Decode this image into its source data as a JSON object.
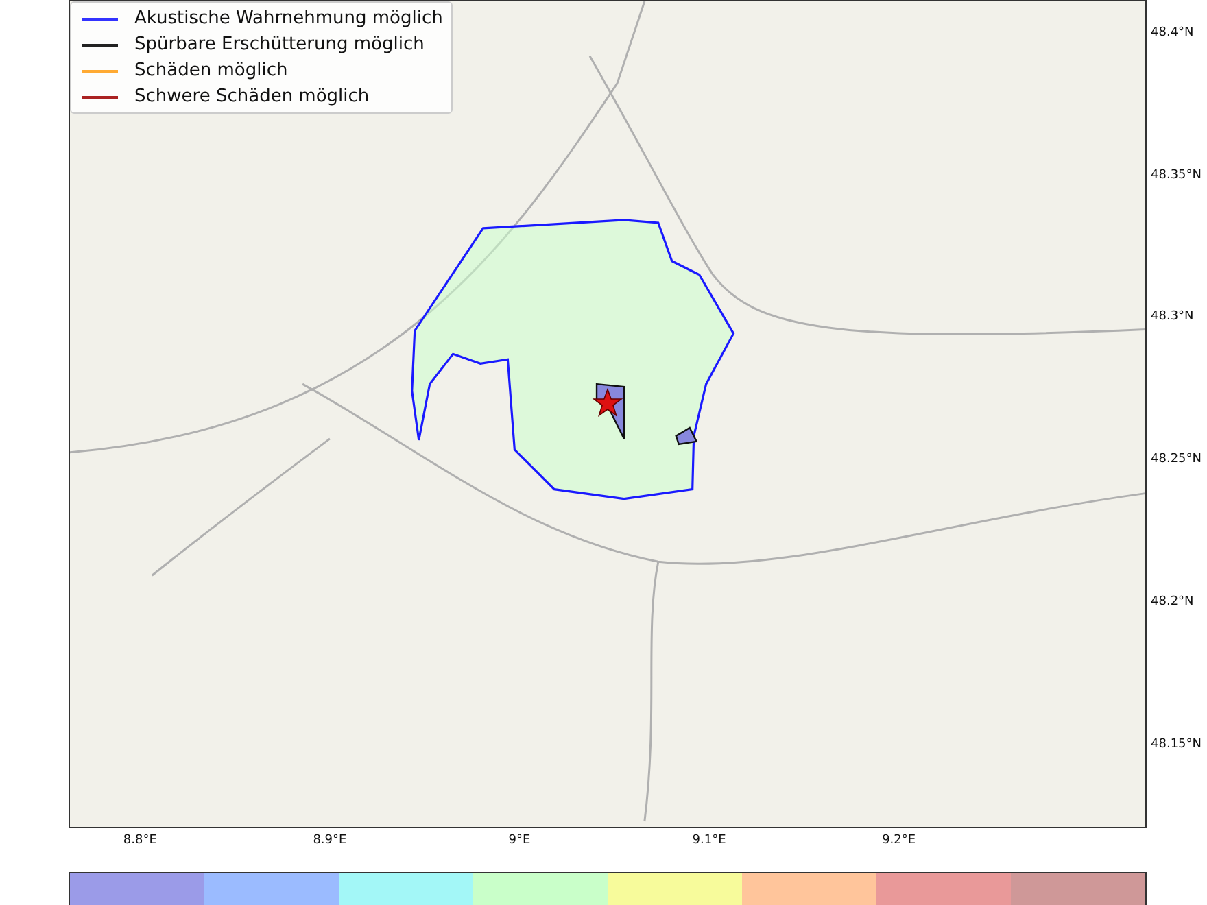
{
  "legend": [
    {
      "label": "Akustische Wahrnehmung möglich",
      "color": "#3333ff"
    },
    {
      "label": "Spürbare Erschütterung möglich",
      "color": "#222222"
    },
    {
      "label": "Schäden möglich",
      "color": "#ffaa33"
    },
    {
      "label": "Schwere Schäden möglich",
      "color": "#aa2222"
    }
  ],
  "x_ticks": [
    "8.8°E",
    "8.9°E",
    "9°E",
    "9.1°E",
    "9.2°E"
  ],
  "y_ticks": [
    "48.4°N",
    "48.35°N",
    "48.3°N",
    "48.25°N",
    "48.2°N",
    "48.15°N"
  ],
  "colorbar": [
    {
      "color": "#9b9be8"
    },
    {
      "color": "#9bbbff"
    },
    {
      "color": "#a3f7f7"
    },
    {
      "color": "#c9ffc9"
    },
    {
      "color": "#f7fb9b"
    },
    {
      "color": "#ffc59b"
    },
    {
      "color": "#e99999"
    },
    {
      "color": "#cf9898"
    }
  ]
}
